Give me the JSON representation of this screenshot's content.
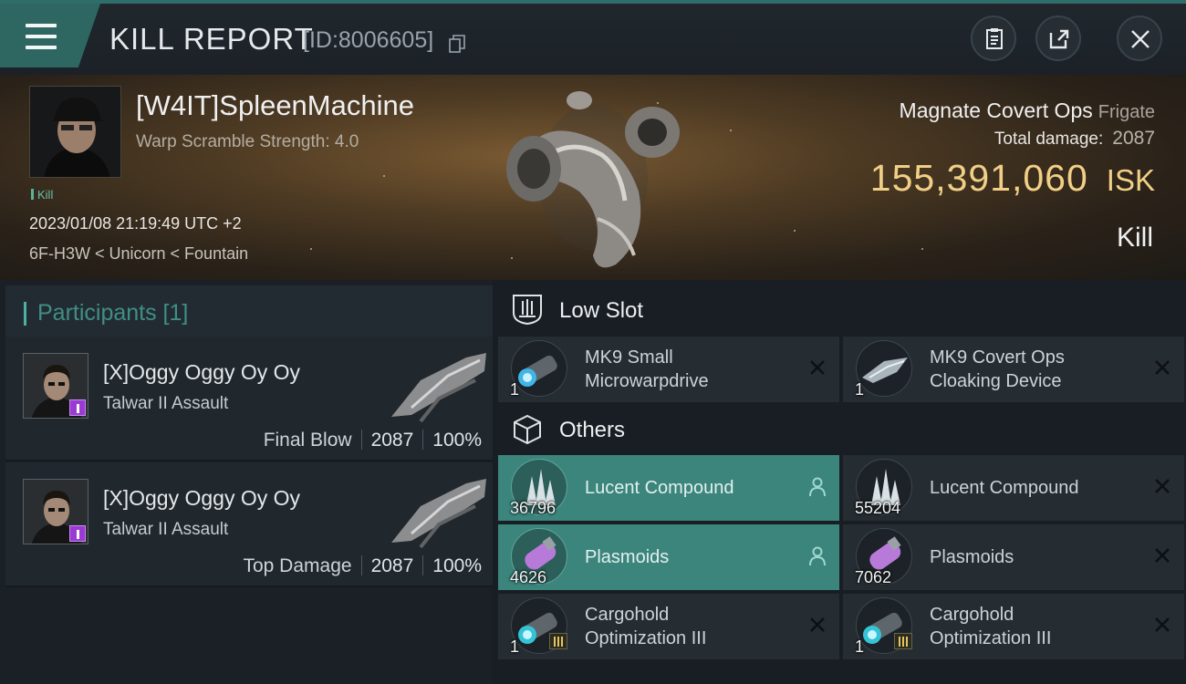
{
  "header": {
    "title": "KILL REPORT",
    "report_id": "[ID:8006605]"
  },
  "victim": {
    "pilot": "[W4IT]SpleenMachine",
    "warp_scramble": "Warp Scramble Strength: 4.0",
    "tag": "Kill",
    "datetime": "2023/01/08 21:19:49 UTC +2",
    "location": "6F-H3W < Unicorn < Fountain",
    "ship": "Magnate Covert Ops",
    "ship_class": "Frigate",
    "total_damage_label": "Total damage:",
    "total_damage": "2087",
    "isk_value": "155,391,060",
    "isk_unit": "ISK",
    "result": "Kill"
  },
  "participants": {
    "title": "Participants [1]",
    "items": [
      {
        "name": "[X]Oggy Oggy Oy Oy",
        "ship": "Talwar II Assault",
        "role": "Final Blow",
        "damage": "2087",
        "percent": "100%"
      },
      {
        "name": "[X]Oggy Oggy Oy Oy",
        "ship": "Talwar II Assault",
        "role": "Top Damage",
        "damage": "2087",
        "percent": "100%"
      }
    ]
  },
  "low_slot": {
    "title": "Low Slot",
    "items": [
      {
        "line1": "MK9 Small",
        "line2": "Microwarpdrive",
        "qty": "1",
        "icon": "microwarpdrive-icon"
      },
      {
        "line1": "MK9 Covert Ops",
        "line2": "Cloaking Device",
        "qty": "1",
        "icon": "cloaking-device-icon"
      }
    ]
  },
  "others": {
    "title": "Others",
    "items": [
      {
        "name": "Lucent Compound",
        "qty": "36796",
        "highlighted": true
      },
      {
        "name": "Lucent Compound",
        "qty": "55204",
        "highlighted": false
      },
      {
        "name": "Plasmoids",
        "qty": "4626",
        "highlighted": true
      },
      {
        "name": "Plasmoids",
        "qty": "7062",
        "highlighted": false
      },
      {
        "line1": "Cargohold",
        "line2": "Optimization III",
        "qty": "1"
      },
      {
        "line1": "Cargohold",
        "line2": "Optimization III",
        "qty": "1"
      }
    ]
  },
  "colors": {
    "accent": "#3b857d",
    "isk": "#f1cf86",
    "highlight_row": "#3b857d"
  }
}
